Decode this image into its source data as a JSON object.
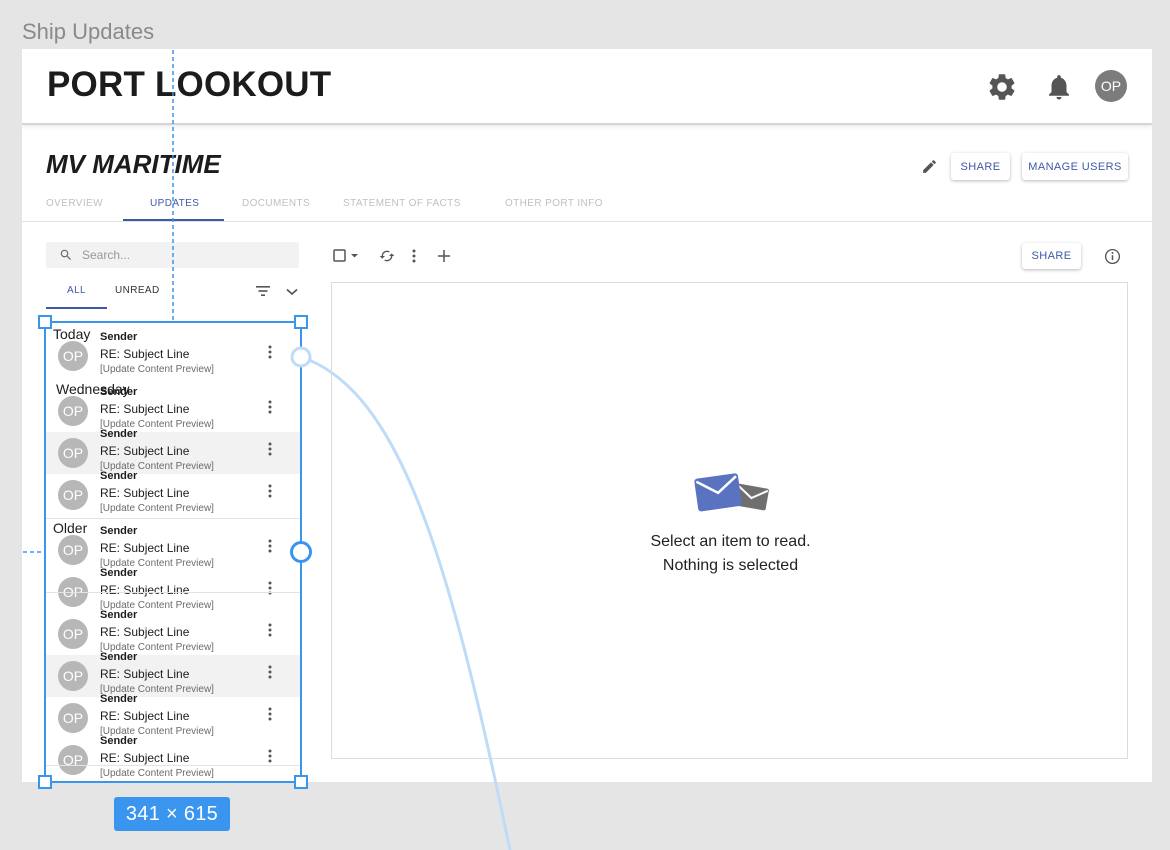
{
  "frame_label": "Ship Updates",
  "header": {
    "logo": "PORT LOOKOUT",
    "avatar_initials": "OP",
    "icons": [
      "gear-icon",
      "bell-icon"
    ]
  },
  "vessel": {
    "name": "MV MARITIME",
    "share_label": "SHARE",
    "manage_users_label": "MANAGE USERS"
  },
  "tabs": [
    {
      "label": "OVERVIEW",
      "active": false
    },
    {
      "label": "UPDATES",
      "active": true
    },
    {
      "label": "DOCUMENTS",
      "active": false
    },
    {
      "label": "STATEMENT OF FACTS",
      "active": false
    },
    {
      "label": "OTHER PORT INFO",
      "active": false
    }
  ],
  "search": {
    "placeholder": "Search..."
  },
  "filters": {
    "all_label": "ALL",
    "unread_label": "UNREAD"
  },
  "groups": [
    "Today",
    "Wednesday",
    "Older"
  ],
  "messages": [
    {
      "group": "Today",
      "initials": "OP",
      "sender": "Sender",
      "subject": "RE: Subject Line",
      "preview": "[Update Content Preview]"
    },
    {
      "group": "Wednesday",
      "initials": "OP",
      "sender": "Sender",
      "subject": "RE: Subject Line",
      "preview": "[Update Content Preview]"
    },
    {
      "group": "Wednesday",
      "initials": "OP",
      "sender": "Sender",
      "subject": "RE: Subject Line",
      "preview": "[Update Content Preview]"
    },
    {
      "group": "Wednesday",
      "initials": "OP",
      "sender": "Sender",
      "subject": "RE: Subject Line",
      "preview": "[Update Content Preview]"
    },
    {
      "group": "Older",
      "initials": "OP",
      "sender": "Sender",
      "subject": "RE: Subject Line",
      "preview": "[Update Content Preview]"
    },
    {
      "group": "Older",
      "initials": "OP",
      "sender": "Sender",
      "subject": "RE: Subject Line",
      "preview": "[Update Content Preview]"
    },
    {
      "group": "Older",
      "initials": "OP",
      "sender": "Sender",
      "subject": "RE: Subject Line",
      "preview": "[Update Content Preview]"
    },
    {
      "group": "Older",
      "initials": "OP",
      "sender": "Sender",
      "subject": "RE: Subject Line",
      "preview": "[Update Content Preview]"
    },
    {
      "group": "Older",
      "initials": "OP",
      "sender": "Sender",
      "subject": "RE: Subject Line",
      "preview": "[Update Content Preview]"
    },
    {
      "group": "Older",
      "initials": "OP",
      "sender": "Sender",
      "subject": "RE: Subject Line",
      "preview": "[Update Content Preview]"
    }
  ],
  "reading_pane": {
    "share_label": "SHARE",
    "empty_line1": "Select an item to read.",
    "empty_line2": "Nothing is selected"
  },
  "selection_overlay": {
    "dimensions": "341 × 615"
  },
  "colors": {
    "accent": "#3e5aa6",
    "selection": "#3a95ef",
    "envelope_front": "#5a73c0",
    "envelope_back": "#6f6f6f"
  }
}
